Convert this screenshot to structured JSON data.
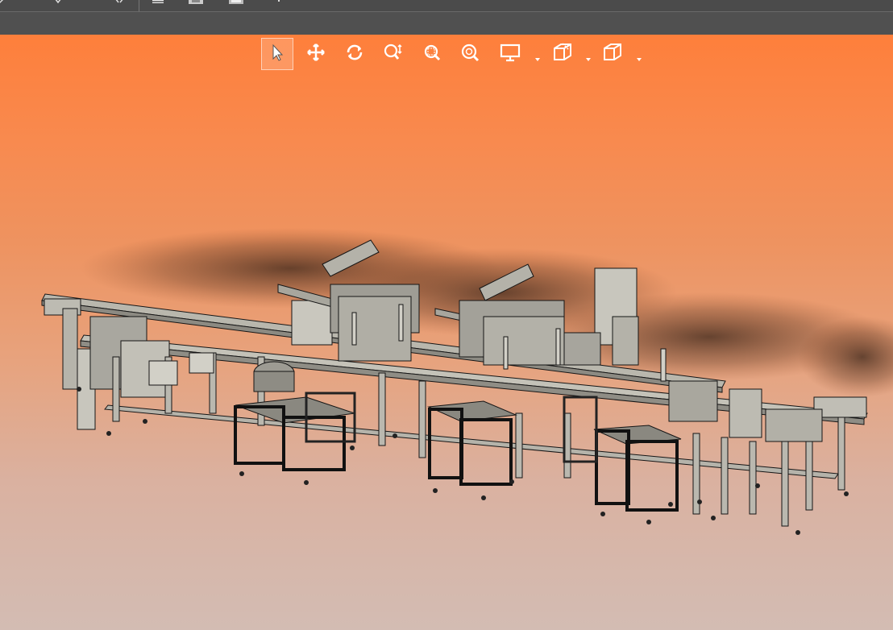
{
  "app": {
    "topbar_icons": [
      "undo-icon",
      "redo-icon",
      "expand-icon",
      "box-icon",
      "save-icon",
      "print-icon",
      "pin-icon"
    ]
  },
  "viewport": {
    "background_top": "#fe7f3b",
    "background_bottom": "#d3bcb3",
    "model_name": "automated-assembly-line",
    "tools": [
      {
        "name": "select-tool",
        "icon": "pointer-icon",
        "active": true
      },
      {
        "name": "pan-tool",
        "icon": "move-icon",
        "active": false
      },
      {
        "name": "rotate-tool",
        "icon": "rotate-icon",
        "active": false
      },
      {
        "name": "zoom-tool",
        "icon": "zoom-updown-icon",
        "active": false
      },
      {
        "name": "zoom-window-tool",
        "icon": "zoom-window-icon",
        "active": false
      },
      {
        "name": "zoom-fit-tool",
        "icon": "zoom-fit-icon",
        "active": false
      },
      {
        "name": "display-mode-tool",
        "icon": "monitor-icon",
        "active": false,
        "dropdown": true
      },
      {
        "name": "section-view-tool",
        "icon": "section-cube-icon",
        "active": false,
        "dropdown": true
      },
      {
        "name": "view-orientation-tool",
        "icon": "cube-icon",
        "active": false,
        "dropdown": true
      }
    ]
  }
}
